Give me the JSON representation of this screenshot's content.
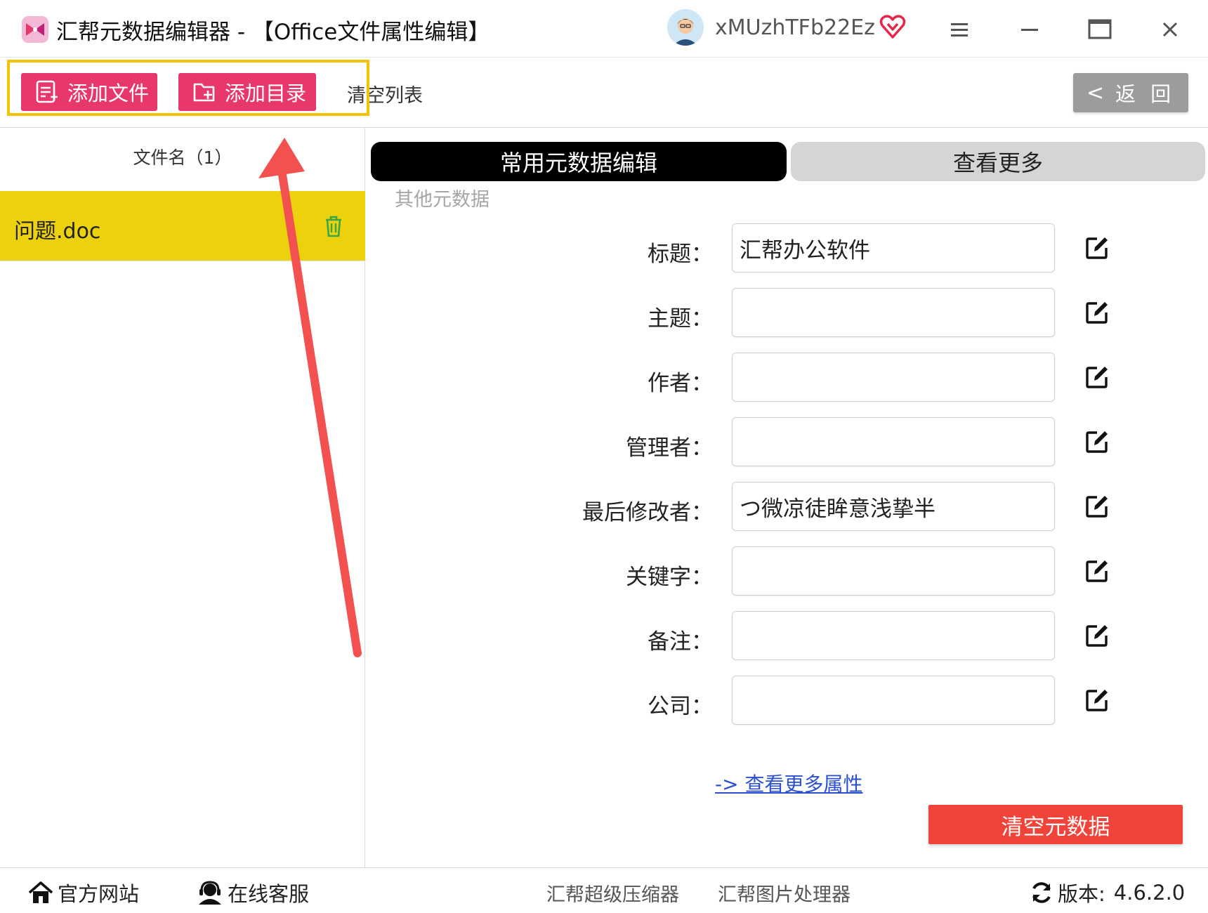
{
  "window": {
    "title": "汇帮元数据编辑器 - 【Office文件属性编辑】",
    "username": "xMUzhTFb22Ez"
  },
  "toolbar": {
    "add_file": "添加文件",
    "add_dir": "添加目录",
    "clear_list": "清空列表",
    "back": "返 回"
  },
  "file_list": {
    "header": "文件名（1）",
    "files": [
      {
        "name": "问题.doc"
      }
    ]
  },
  "tabs": {
    "active": "常用元数据编辑",
    "inactive": "查看更多",
    "sub": "其他元数据"
  },
  "fields": [
    {
      "label": "标题：",
      "value": "汇帮办公软件"
    },
    {
      "label": "主题：",
      "value": ""
    },
    {
      "label": "作者：",
      "value": ""
    },
    {
      "label": "管理者：",
      "value": ""
    },
    {
      "label": "最后修改者：",
      "value": "つ微凉徒眸意浅挚半"
    },
    {
      "label": "关键字：",
      "value": ""
    },
    {
      "label": "备注：",
      "value": ""
    },
    {
      "label": "公司：",
      "value": ""
    }
  ],
  "more_link": "-> 查看更多属性",
  "clear_meta": "清空元数据",
  "footer": {
    "website": "官方网站",
    "support": "在线客服",
    "compressor": "汇帮超级压缩器",
    "image_tool": "汇帮图片处理器",
    "version_label": "版本:",
    "version": "4.6.2.0"
  },
  "colors": {
    "accent_pink": "#e8386b",
    "selected_row": "#ecd20c",
    "highlight_border": "#f5c200",
    "annotation_arrow": "#f2514f",
    "clear_button": "#f0443a"
  },
  "icons": [
    "app-logo-icon",
    "vip-heart-icon",
    "menu-icon",
    "minimize-icon",
    "maximize-icon",
    "close-icon",
    "add-file-icon",
    "add-folder-icon",
    "trash-icon",
    "edit-icon",
    "home-icon",
    "support-icon",
    "refresh-icon"
  ]
}
